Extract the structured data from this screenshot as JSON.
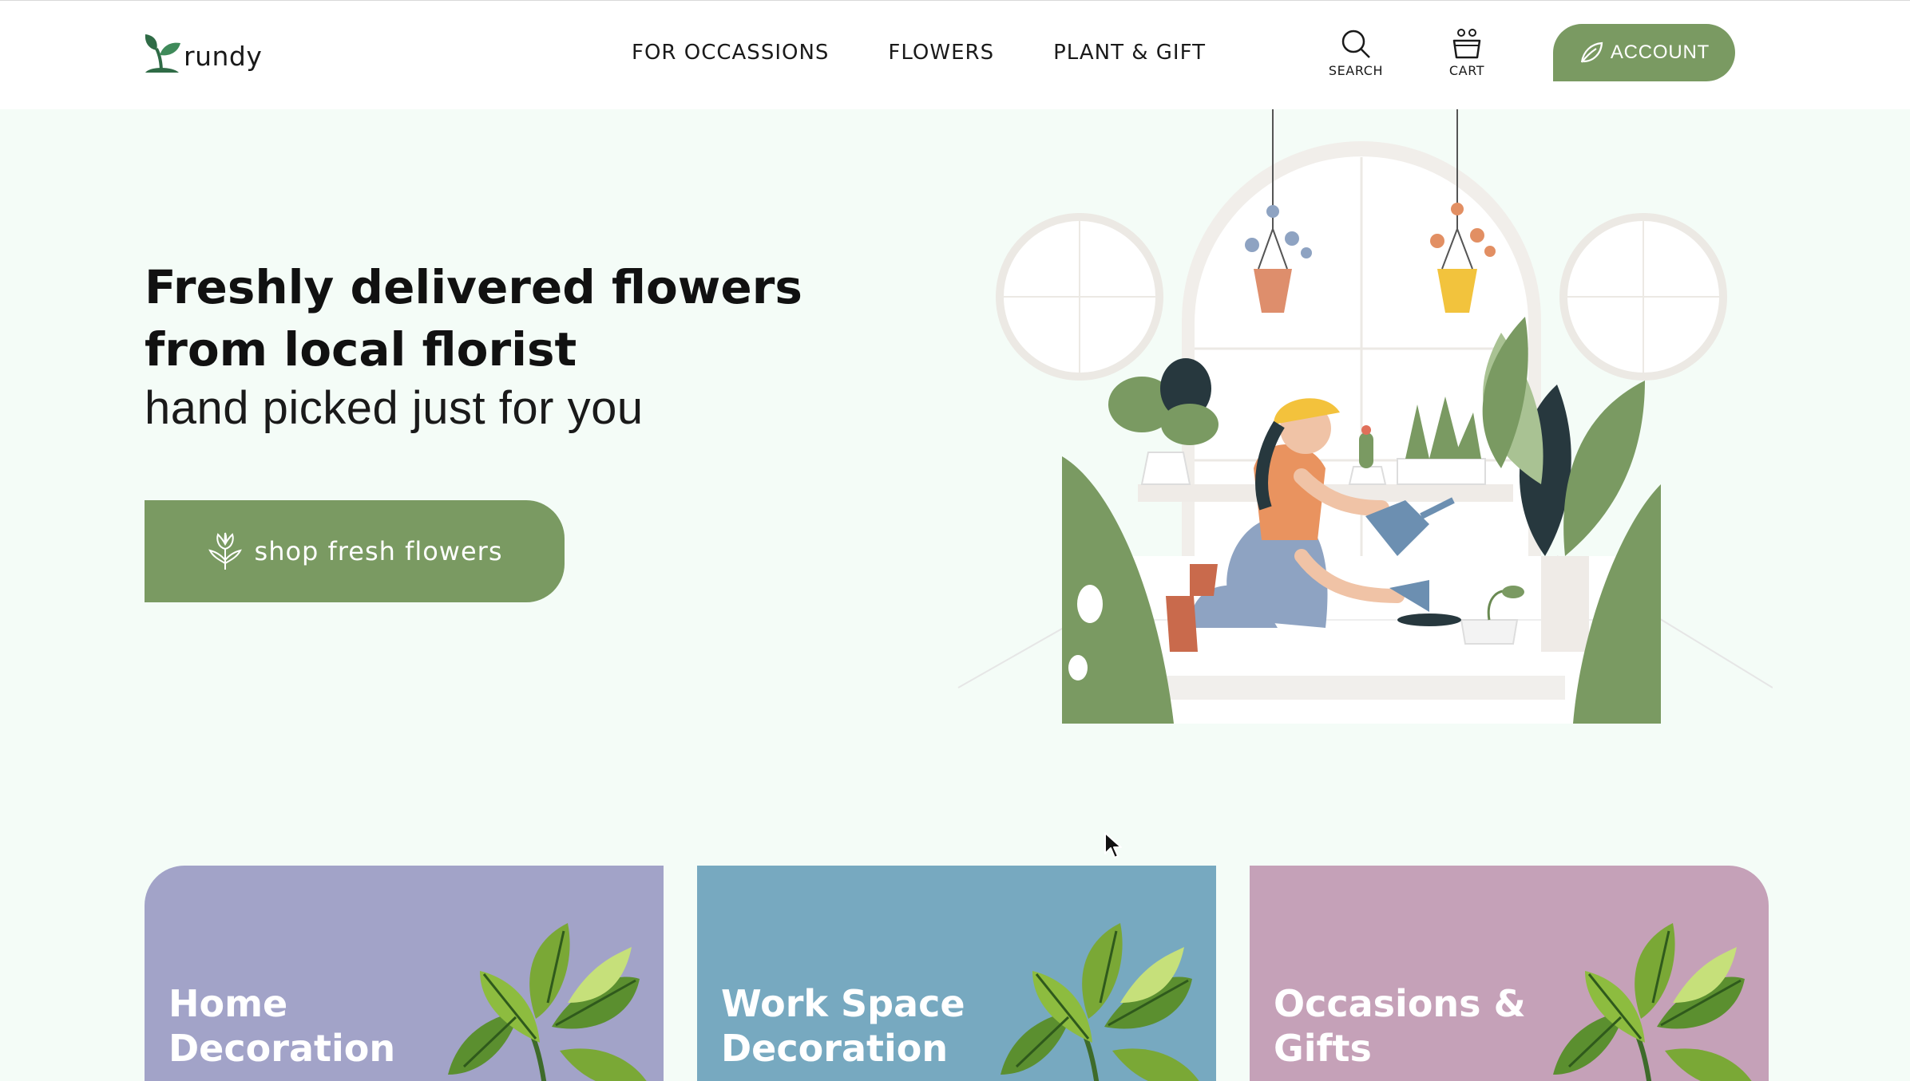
{
  "header": {
    "logo_text": "rundy",
    "nav": [
      {
        "label": "FOR OCCASSIONS"
      },
      {
        "label": "FLOWERS"
      },
      {
        "label": "PLANT & GIFT"
      }
    ],
    "search_label": "SEARCH",
    "cart_label": "CART",
    "account_label": "ACCOUNT"
  },
  "hero": {
    "title": "Freshly delivered flowers from local florist",
    "subtitle": "hand picked just for you",
    "cta_label": "shop fresh flowers"
  },
  "categories": [
    {
      "title": "Home Decoration",
      "color": "#a2a3c8"
    },
    {
      "title": "Work Space Decoration",
      "color": "#77a9c0"
    },
    {
      "title": "Occasions & Gifts",
      "color": "#c5a1b8"
    }
  ],
  "colors": {
    "brand_green": "#7a9a62",
    "hero_bg": "#f4fcf7"
  },
  "icons": {
    "logo": "sprout-icon",
    "search": "search-icon",
    "cart": "basket-icon",
    "account": "leaf-icon",
    "cta": "tulip-icon"
  }
}
